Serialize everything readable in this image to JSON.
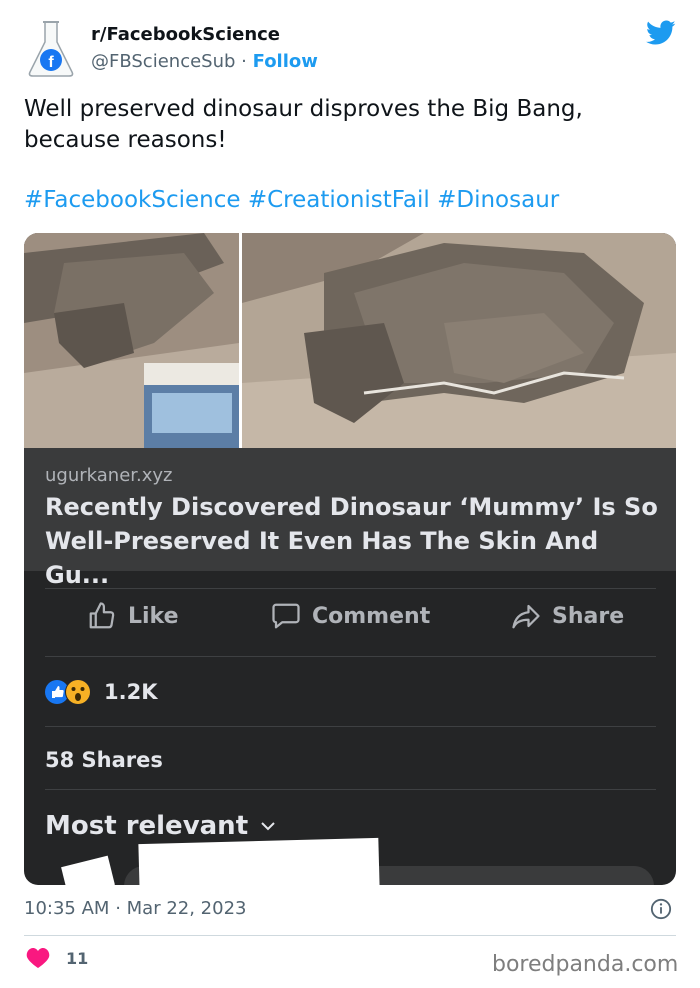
{
  "account": {
    "name": "r/FacebookScience",
    "handle": "@FBScienceSub",
    "separator": "·",
    "follow_label": "Follow"
  },
  "tweet": {
    "text": "Well preserved dinosaur disproves the Big Bang, because reasons!",
    "hashtags": [
      "#FacebookScience",
      "#CreationistFail",
      "#Dinosaur"
    ]
  },
  "facebook_post": {
    "link_domain": "ugurkaner.xyz",
    "link_title": "Recently Discovered Dinosaur ‘Mummy’ Is So Well-Preserved It Even Has The Skin And Gu...",
    "actions": [
      "Like",
      "Comment",
      "Share"
    ],
    "reaction_count": "1.2K",
    "shares": "58 Shares",
    "sort_label": "Most relevant"
  },
  "footer": {
    "time": "10:35 AM",
    "date_separator": "·",
    "date": "Mar 22, 2023",
    "like_count": "11",
    "watermark": "boredpanda.com"
  },
  "colors": {
    "twitter_blue": "#1d9bf0",
    "heart": "#f91880",
    "fb_dark": "#242526"
  }
}
